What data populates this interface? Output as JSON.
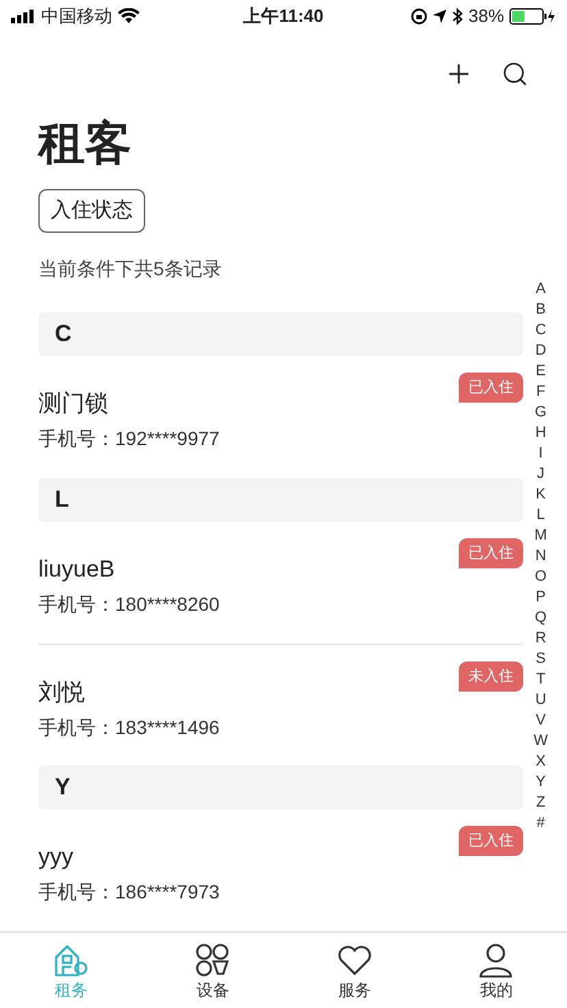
{
  "status_bar": {
    "carrier": "中国移动",
    "time": "上午11:40",
    "battery": "38%"
  },
  "title": "租客",
  "filter_button": "入住状态",
  "record_count": "当前条件下共5条记录",
  "sections": [
    {
      "letter": "C",
      "tenants": [
        {
          "name": "测门锁",
          "phone": "手机号：192****9977",
          "status": "已入住"
        }
      ]
    },
    {
      "letter": "L",
      "tenants": [
        {
          "name": "liuyueB",
          "phone": "手机号：180****8260",
          "status": "已入住"
        },
        {
          "name": "刘悦",
          "phone": "手机号：183****1496",
          "status": "未入住"
        }
      ]
    },
    {
      "letter": "Y",
      "tenants": [
        {
          "name": "yyy",
          "phone": "手机号：186****7973",
          "status": "已入住"
        }
      ]
    }
  ],
  "index_letters": [
    "A",
    "B",
    "C",
    "D",
    "E",
    "F",
    "G",
    "H",
    "I",
    "J",
    "K",
    "L",
    "M",
    "N",
    "O",
    "P",
    "Q",
    "R",
    "S",
    "T",
    "U",
    "V",
    "W",
    "X",
    "Y",
    "Z",
    "#"
  ],
  "tabs": [
    {
      "label": "租务",
      "kind": "house",
      "selected": true
    },
    {
      "label": "设备",
      "kind": "grid",
      "selected": false
    },
    {
      "label": "服务",
      "kind": "heart",
      "selected": false
    },
    {
      "label": "我的",
      "kind": "person",
      "selected": false
    }
  ]
}
